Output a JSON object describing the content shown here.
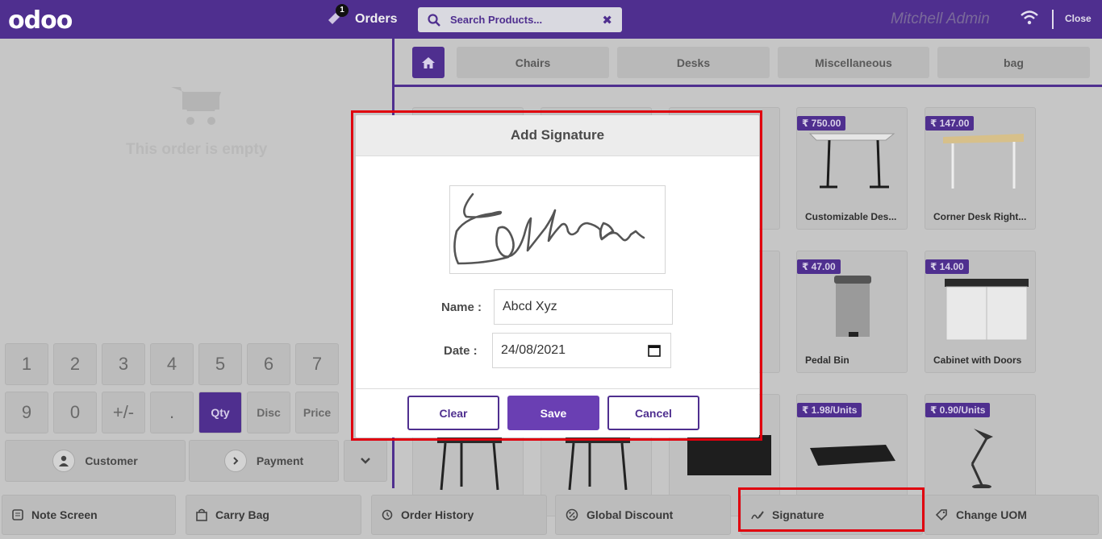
{
  "header": {
    "logo": "odoo",
    "orders_label": "Orders",
    "orders_count": "1",
    "search_placeholder": "Search Products...",
    "user_name": "Mitchell Admin",
    "close_label": "Close"
  },
  "order": {
    "empty_text": "This order is empty"
  },
  "numpad": {
    "row1": [
      "1",
      "2",
      "3",
      "4",
      "5",
      "6",
      "7"
    ],
    "row2": [
      "9",
      "0",
      "+/-",
      ".",
      "Qty",
      "Disc",
      "Price"
    ],
    "customer_label": "Customer",
    "payment_label": "Payment"
  },
  "categories": [
    "Chairs",
    "Desks",
    "Miscellaneous",
    "bag"
  ],
  "products": [
    {
      "name": "Customizable Des...",
      "price": "₹ 750.00"
    },
    {
      "name": "Corner Desk Right...",
      "price": "₹ 147.00"
    },
    {
      "name": "Pedal Bin",
      "price": "₹ 47.00"
    },
    {
      "name": "Cabinet with Doors",
      "price": "₹ 14.00"
    },
    {
      "name": "",
      "price": "₹ 1.98/Units"
    },
    {
      "name": "",
      "price": "₹ 0.90/Units"
    }
  ],
  "control_buttons": [
    "Note Screen",
    "Carry Bag",
    "Order History",
    "Global Discount",
    "Signature",
    "Change UOM"
  ],
  "modal": {
    "title": "Add Signature",
    "name_label": "Name :",
    "name_value": "Abcd Xyz",
    "date_label": "Date :",
    "date_value": "24/08/2021",
    "clear_label": "Clear",
    "save_label": "Save",
    "cancel_label": "Cancel"
  },
  "colors": {
    "brand": "#4f2f8f",
    "highlight": "#e0000e",
    "save": "#6a3fb3"
  },
  "icons": [
    "cart-icon",
    "search-icon",
    "close-icon",
    "wifi-icon",
    "home-icon",
    "user-icon",
    "chevron-right-icon",
    "chevron-down-icon",
    "note-icon",
    "bag-icon",
    "history-icon",
    "percent-icon",
    "signature-icon",
    "tag-icon",
    "calendar-icon"
  ]
}
